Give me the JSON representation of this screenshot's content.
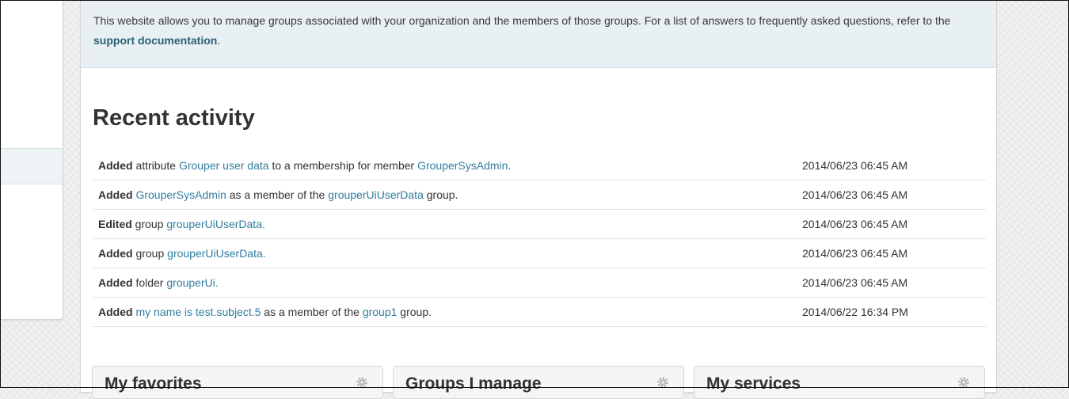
{
  "intro": {
    "text": "This website allows you to manage groups associated with your organization and the members of those groups. For a list of answers to frequently asked questions, refer to the ",
    "link": "support documentation",
    "end": "."
  },
  "recent_activity": {
    "title": "Recent activity",
    "items": [
      {
        "parts": [
          {
            "t": "Added",
            "b": true
          },
          {
            "t": " attribute "
          },
          {
            "t": "Grouper user data",
            "l": true
          },
          {
            "t": " to a membership for member "
          },
          {
            "t": "GrouperSysAdmin.",
            "l": true
          }
        ],
        "time": "2014/06/23 06:45 AM"
      },
      {
        "parts": [
          {
            "t": "Added",
            "b": true
          },
          {
            "t": " "
          },
          {
            "t": "GrouperSysAdmin",
            "l": true
          },
          {
            "t": " as a member of the "
          },
          {
            "t": "grouperUiUserData",
            "l": true
          },
          {
            "t": " group."
          }
        ],
        "time": "2014/06/23 06:45 AM"
      },
      {
        "parts": [
          {
            "t": "Edited",
            "b": true
          },
          {
            "t": " group "
          },
          {
            "t": "grouperUiUserData.",
            "l": true
          }
        ],
        "time": "2014/06/23 06:45 AM"
      },
      {
        "parts": [
          {
            "t": "Added",
            "b": true
          },
          {
            "t": " group "
          },
          {
            "t": "grouperUiUserData.",
            "l": true
          }
        ],
        "time": "2014/06/23 06:45 AM"
      },
      {
        "parts": [
          {
            "t": "Added",
            "b": true
          },
          {
            "t": " folder "
          },
          {
            "t": "grouperUi.",
            "l": true
          }
        ],
        "time": "2014/06/23 06:45 AM"
      },
      {
        "parts": [
          {
            "t": "Added",
            "b": true
          },
          {
            "t": " "
          },
          {
            "t": "my name is test.subject.5",
            "l": true
          },
          {
            "t": " as a member of the "
          },
          {
            "t": "group1",
            "l": true
          },
          {
            "t": " group."
          }
        ],
        "time": "2014/06/22 16:34 PM"
      }
    ]
  },
  "widgets": [
    {
      "title": "My favorites",
      "icon": "gear-icon"
    },
    {
      "title": "Groups I manage",
      "icon": "gear-icon"
    },
    {
      "title": "My services",
      "icon": "gear-icon"
    }
  ],
  "colors": {
    "link": "#2f7ea0",
    "info_bg": "#e8f0f3",
    "doc_link": "#2c5f75"
  }
}
